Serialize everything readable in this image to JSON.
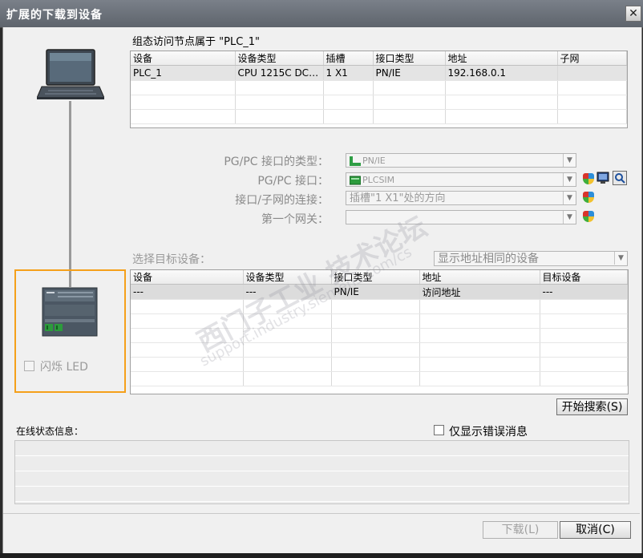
{
  "window": {
    "title": "扩展的下载到设备",
    "close_label": "✕"
  },
  "configured": {
    "heading": "组态访问节点属于 \"PLC_1\"",
    "columns": [
      "设备",
      "设备类型",
      "插槽",
      "接口类型",
      "地址",
      "子网"
    ],
    "rows": [
      [
        "PLC_1",
        "CPU 1215C DC/D...",
        "1 X1",
        "PN/IE",
        "192.168.0.1",
        ""
      ]
    ]
  },
  "interface": {
    "type_label": "PG/PC 接口的类型：",
    "type_value": "PN/IE",
    "pgpc_label": "PG/PC 接口：",
    "pgpc_value": "PLCSIM",
    "subnet_label": "接口/子网的连接：",
    "subnet_value": "插槽\"1 X1\"处的方向",
    "gateway_label": "第一个网关：",
    "gateway_value": ""
  },
  "target": {
    "heading": "选择目标设备：",
    "filter_value": "显示地址相同的设备",
    "columns": [
      "设备",
      "设备类型",
      "接口类型",
      "地址",
      "目标设备"
    ],
    "rows": [
      [
        "---",
        "---",
        "PN/IE",
        "访问地址",
        "---"
      ]
    ]
  },
  "flash_led_label": "闪烁 LED",
  "start_search_label": "开始搜索(S)",
  "status": {
    "label": "在线状态信息：",
    "errors_only_label": "仅显示错误消息"
  },
  "footer": {
    "download_label": "下载(L)",
    "cancel_label": "取消(C)"
  },
  "watermark": {
    "line1": "西门子工业  技术论坛",
    "line2": "support.industry.siemens.com/cs"
  },
  "colors": {
    "highlight_border": "#f5a01a",
    "title_bar": "#6b7078",
    "pn_icon": "#2e9e44"
  }
}
